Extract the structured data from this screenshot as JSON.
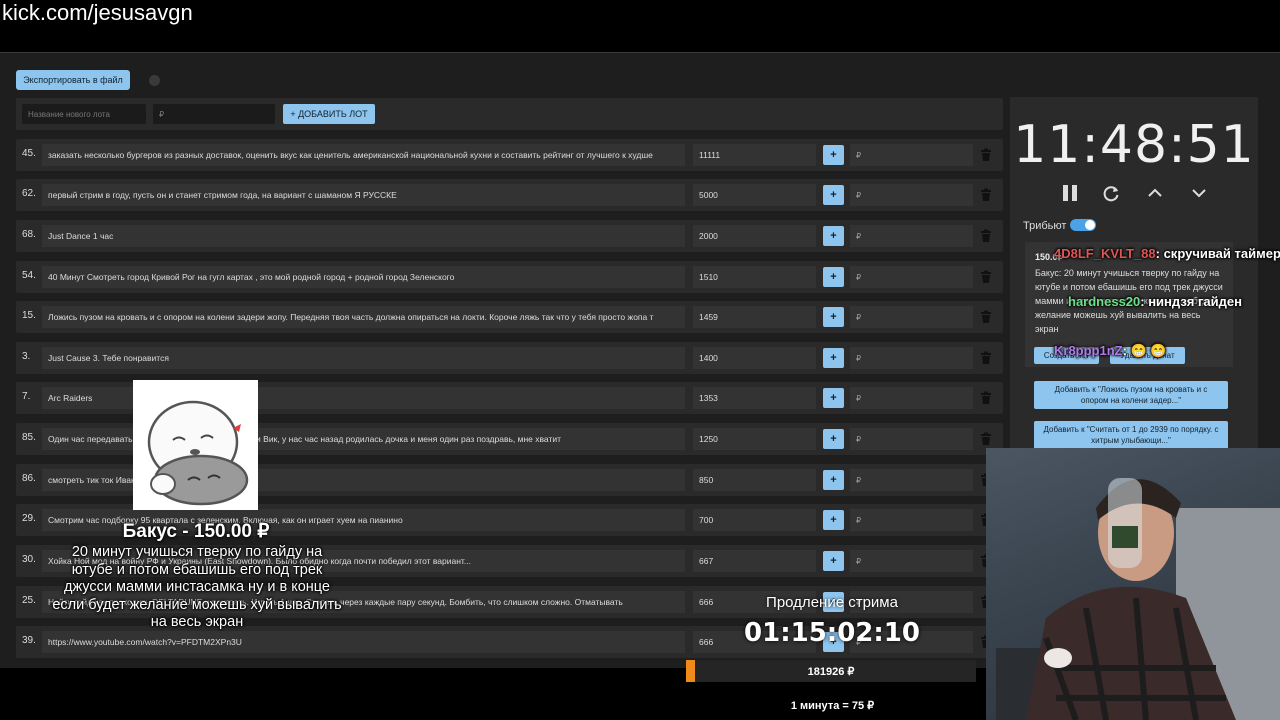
{
  "overlay": {
    "channel_url": "kick.com/jesusavgn"
  },
  "toolbar": {
    "export_label": "Экспортировать в файл"
  },
  "add_lot": {
    "name_placeholder": "Название нового лота",
    "price_placeholder": "₽",
    "button_label": "+ ДОБАВИТЬ ЛОТ"
  },
  "lots": [
    {
      "num": "45.",
      "title": "заказать несколько бургеров из разных доставок, оценить вкус как ценитель американской национальной кухни и составить рейтинг от лучшего к худше",
      "amount": "11111"
    },
    {
      "num": "62.",
      "title": "первый стрим в году, пусть он и станет стримом года, на вариант с шаманом Я РУССКЕ",
      "amount": "5000"
    },
    {
      "num": "68.",
      "title": "Just Dance 1 час",
      "amount": "2000"
    },
    {
      "num": "54.",
      "title": "40 Минут Смотреть город Кривой Рог на гугл картах , это мой родной город + родной город Зеленского",
      "amount": "1510"
    },
    {
      "num": "15.",
      "title": "Ложись пузом на кровать и с опором на колени задери жопу. Передняя твоя часть должна опираться на локти. Короче ляжь так что у тебя просто жопа т",
      "amount": "1459"
    },
    {
      "num": "3.",
      "title": "Just Cause 3. Тебе понравится",
      "amount": "1400"
    },
    {
      "num": "7.",
      "title": "Arc Raiders",
      "amount": "1353"
    },
    {
      "num": "85.",
      "title": "Один час передавать привет от меня, от моей дочери Вик, у нас час назад родилась дочка и меня один раз поздравь, мне хватит",
      "amount": "1250"
    },
    {
      "num": "86.",
      "title": "смотреть тик ток Иван",
      "amount": "850"
    },
    {
      "num": "29.",
      "title": "Смотрим час подборку 95 квартала с зеленским. Включая, как он играет хуем на пианино",
      "amount": "700"
    },
    {
      "num": "30.",
      "title": "Хойка Ной мод на войну РФ и Украины (East Showdown). Было обидно когда почти победил этот вариант...",
      "amount": "667"
    },
    {
      "num": "25.",
      "title": "Найти гайд как проходить DELTARUNE и поиграть. Играть 1 час. Стопать через каждые пару секунд. Бомбить, что слишком сложно. Отматывать",
      "amount": "666"
    },
    {
      "num": "39.",
      "title": "https://www.youtube.com/watch?v=PFDTM2XPn3U",
      "amount": "666"
    }
  ],
  "row_ui": {
    "plus_label": "+",
    "currency_placeholder": "₽"
  },
  "timer": {
    "value": "11:48:51"
  },
  "tribute": {
    "label": "Трибьют"
  },
  "donation_card": {
    "amount": "150.0₽",
    "text": "Бакус: 20 минут учишься тверку по гайду на ютубе и потом ебашишь его под трек джусси мамми инстасамка ну и в конце если будет желание можешь хуй вывалить на весь экран",
    "create_lot_label": "Создать лот",
    "delete_label": "Удалить донат"
  },
  "add_to_buttons": [
    "Добавить к \"Ложись пузом на кровать и с опором на колени задер...\"",
    "Добавить к \"Считать от 1 до 2939 по порядку. с хитрым улыбающи...\""
  ],
  "chat": [
    {
      "user": "4D8LF_KVLT_88",
      "text": ": скручивай таймер",
      "color": "#e05555"
    },
    {
      "user": "hardness20",
      "text": ": ниндзя гайден",
      "color": "#6ee08a"
    },
    {
      "user": "Kr8ppp1nZ",
      "text": ": 😁 😁",
      "color": "#b07ae8"
    }
  ],
  "alert": {
    "title": "Бакус - 150.00 ₽",
    "message": "20 минут учишься тверку по гайду на ютубе и потом ебашишь его под трек джусси мамми инстасамка ну и в конце если будет желание можешь хуй вывалить на весь экран"
  },
  "extension": {
    "label": "Продление стрима",
    "time": "01:15:02:10",
    "total": "181926 ₽",
    "rate": "1 минута = 75 ₽",
    "progress": 0.03
  },
  "colors": {
    "accent": "#8ec5ee",
    "background": "#1e1e1e",
    "row": "#2a2a2a",
    "progress": "#f08a1a"
  }
}
